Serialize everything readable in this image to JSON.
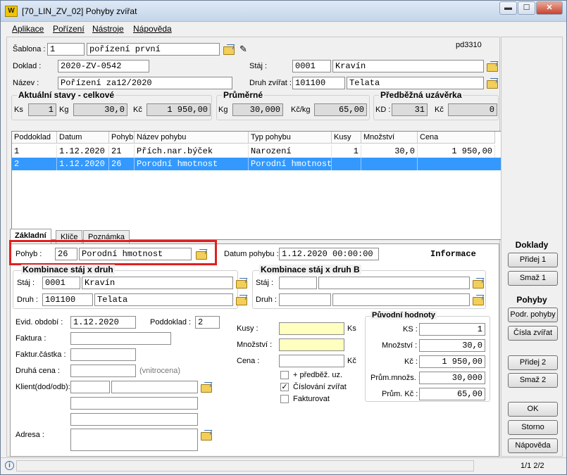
{
  "window": {
    "title": "[70_LIN_ZV_02] Pohyby zvířat",
    "app_icon_text": "W"
  },
  "menu": [
    "Aplikace",
    "Pořízení",
    "Nástroje",
    "Nápověda"
  ],
  "form_id": "pd3310",
  "header": {
    "sablona_label": "Šablona :",
    "sablona_value": "1",
    "sablona_name": "pořízení první",
    "doklad_label": "Doklad :",
    "doklad_value": "2020-ZV-0542",
    "nazev_label": "Název :",
    "nazev_value": "Pořízení za12/2020",
    "staj_label": "Stáj :",
    "staj_code": "0001",
    "staj_name": "Kravín",
    "druh_label": "Druh zvířat :",
    "druh_code": "101100",
    "druh_name": "Telata"
  },
  "aktualni": {
    "title": "Aktuální stavy - celkové",
    "ks_label": "Ks",
    "ks": "1",
    "kg_label": "Kg",
    "kg": "30,0",
    "kc_label": "Kč",
    "kc": "1 950,00"
  },
  "prumerne": {
    "title": "Průměrné",
    "kg_label": "Kg",
    "kg": "30,000",
    "kckg_label": "Kč/kg",
    "kckg": "65,00"
  },
  "uzaverka": {
    "title": "Předběžná uzávěrka",
    "kd_label": "KD :",
    "kd": "31",
    "kc_label": "Kč",
    "kc": "0"
  },
  "grid": {
    "columns": [
      "Poddoklad",
      "Datum",
      "Pohyb",
      "Název pohybu",
      "Typ pohybu",
      "Kusy",
      "Množství",
      "Cena"
    ],
    "rows": [
      [
        "1",
        "1.12.2020",
        "21",
        "Přích.nar.býček",
        "Narození",
        "1",
        "30,0",
        "1 950,00"
      ],
      [
        "2",
        "1.12.2020",
        "26",
        "Porodní hmotnost",
        "Porodní hmotnost",
        "",
        "",
        ""
      ]
    ]
  },
  "tabs": [
    "Základní",
    "Klíče",
    "Poznámka"
  ],
  "detail": {
    "pohyb_label": "Pohyb :",
    "pohyb_code": "26",
    "pohyb_name": "Porodní hmotnost",
    "datum_label": "Datum pohybu :",
    "datum_value": "1.12.2020 00:00:00",
    "informace": "Informace",
    "kombinace_title": "Kombinace stáj x druh",
    "komb_staj_label": "Stáj :",
    "komb_staj_code": "0001",
    "komb_staj_name": "Kravín",
    "komb_druh_label": "Druh :",
    "komb_druh_code": "101100",
    "komb_druh_name": "Telata",
    "kombinace_b_title": "Kombinace stáj x druh B",
    "kombb_staj_label": "Stáj :",
    "kombb_druh_label": "Druh :",
    "evid_label": "Evid. období :",
    "evid_value": "1.12.2020",
    "poddoklad_label": "Poddoklad :",
    "poddoklad_value": "2",
    "faktura_label": "Faktura :",
    "faktur_castka_label": "Faktur.částka :",
    "druha_cena_label": "Druhá cena :",
    "vnitrocena": "(vnitrocena)",
    "klient_label": "Klient(dod/odb):",
    "adresa_label": "Adresa :",
    "kusy_label": "Kusy :",
    "kusy_unit": "Ks",
    "mnozstvi_label": "Množství :",
    "cena_label": "Cena :",
    "cena_unit": "Kč",
    "chk_predbez": "+ předběž. uz.",
    "chk_cislovani": "Číslování zvířat",
    "chk_fakturovat": "Fakturovat",
    "puvodni_title": "Původní hodnoty",
    "p_ks_label": "KS :",
    "p_ks": "1",
    "p_mnozstvi_label": "Množství :",
    "p_mnozstvi": "30,0",
    "p_kc_label": "Kč :",
    "p_kc": "1 950,00",
    "p_prum_mnozs_label": "Prům.množs. :",
    "p_prum_mnozs": "30,000",
    "p_prum_kc_label": "Prům. Kč :",
    "p_prum_kc": "65,00"
  },
  "side": {
    "doklady": "Doklady",
    "pridej1": "Přidej 1",
    "smaz1": "Smaž 1",
    "pohyby": "Pohyby",
    "podr_pohyby": "Podr. pohyby",
    "cisla_zvirat": "Čísla zvířat",
    "pridej2": "Přidej 2",
    "smaz2": "Smaž 2",
    "ok": "OK",
    "storno": "Storno",
    "napoveda": "Nápověda"
  },
  "status": {
    "pages": "1/1   2/2"
  }
}
